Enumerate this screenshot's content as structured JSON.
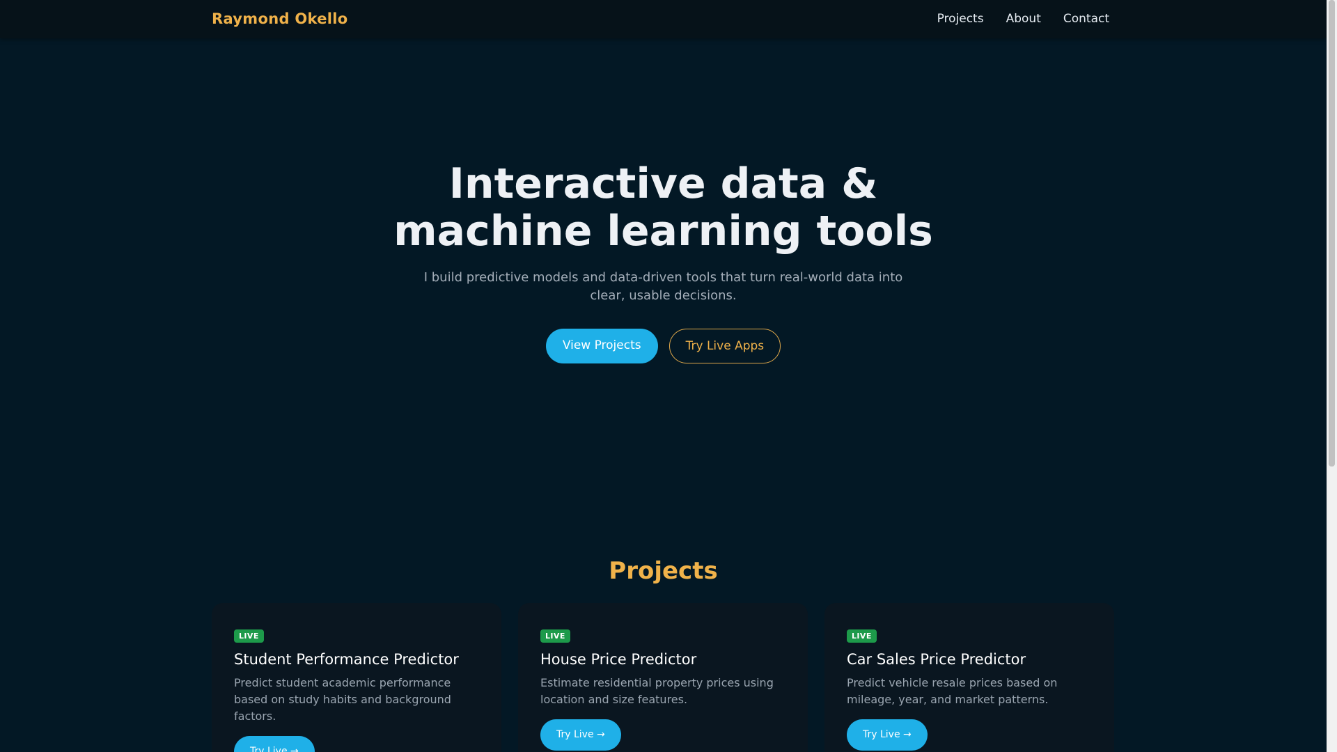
{
  "navbar": {
    "brand": "Raymond Okello",
    "links": [
      {
        "label": "Projects"
      },
      {
        "label": "About"
      },
      {
        "label": "Contact"
      }
    ]
  },
  "hero": {
    "title_line1": "Interactive data &",
    "title_line2": "machine learning tools",
    "subtitle": "I build predictive models and data-driven tools that turn real-world data into clear, usable decisions.",
    "primary_button": "View Projects",
    "secondary_button": "Try Live Apps"
  },
  "projects": {
    "heading": "Projects",
    "cards": [
      {
        "badge": "LIVE",
        "title": "Student Performance Predictor",
        "description": "Predict student academic performance based on study habits and background factors.",
        "button": "Try Live →"
      },
      {
        "badge": "LIVE",
        "title": "House Price Predictor",
        "description": "Estimate residential property prices using location and size features.",
        "button": "Try Live →"
      },
      {
        "badge": "LIVE",
        "title": "Car Sales Price Predictor",
        "description": "Predict vehicle resale prices based on mileage, year, and market patterns.",
        "button": "Try Live →"
      }
    ]
  },
  "colors": {
    "background": "#031825",
    "accent": "#f0b24a",
    "primary": "#1fb0e8",
    "badge": "#1d9a4a"
  }
}
